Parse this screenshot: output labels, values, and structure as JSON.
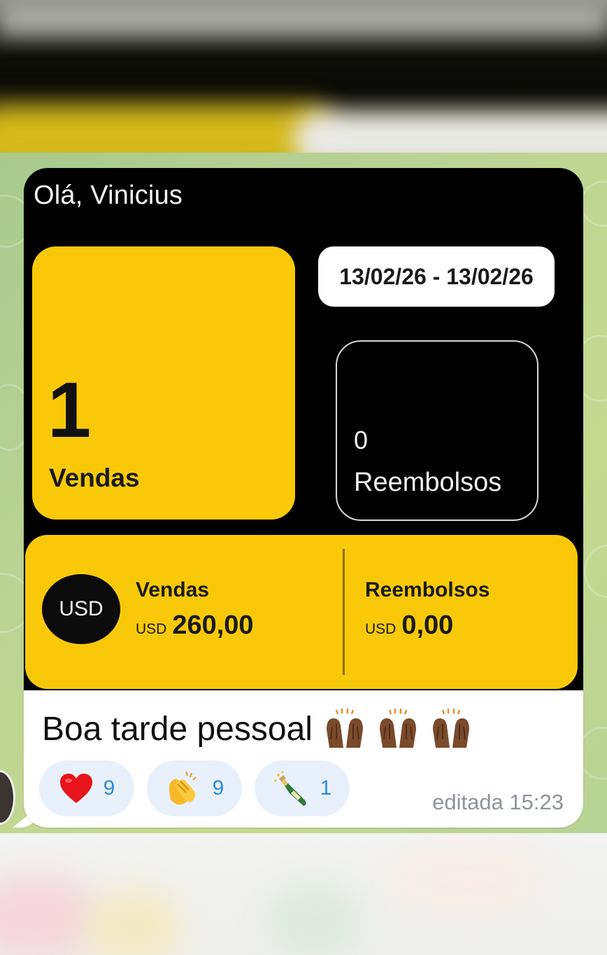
{
  "app": "Telegram chat",
  "media": {
    "greeting": "Olá, Vinicius",
    "date_range": "13/02/26 - 13/02/26",
    "sales": {
      "count": "1",
      "label": "Vendas"
    },
    "refunds": {
      "count": "0",
      "label": "Reembolsos"
    },
    "summary": {
      "currency_badge": "USD",
      "sales_title": "Vendas",
      "sales_currency": "USD",
      "sales_amount": "260,00",
      "refunds_title": "Reembolsos",
      "refunds_currency": "USD",
      "refunds_amount": "0,00"
    },
    "colors": {
      "accent_yellow": "#f9c909",
      "background": "#000000"
    }
  },
  "message": {
    "text": "Boa tarde pessoal",
    "emojis": [
      "raising-hands-icon",
      "raising-hands-icon",
      "raising-hands-icon"
    ],
    "meta": "editada 15:23"
  },
  "reactions": [
    {
      "icon": "heart-icon",
      "count": "9"
    },
    {
      "icon": "clapping-hands-icon",
      "count": "9"
    },
    {
      "icon": "champagne-bottle-icon",
      "count": "1"
    }
  ]
}
